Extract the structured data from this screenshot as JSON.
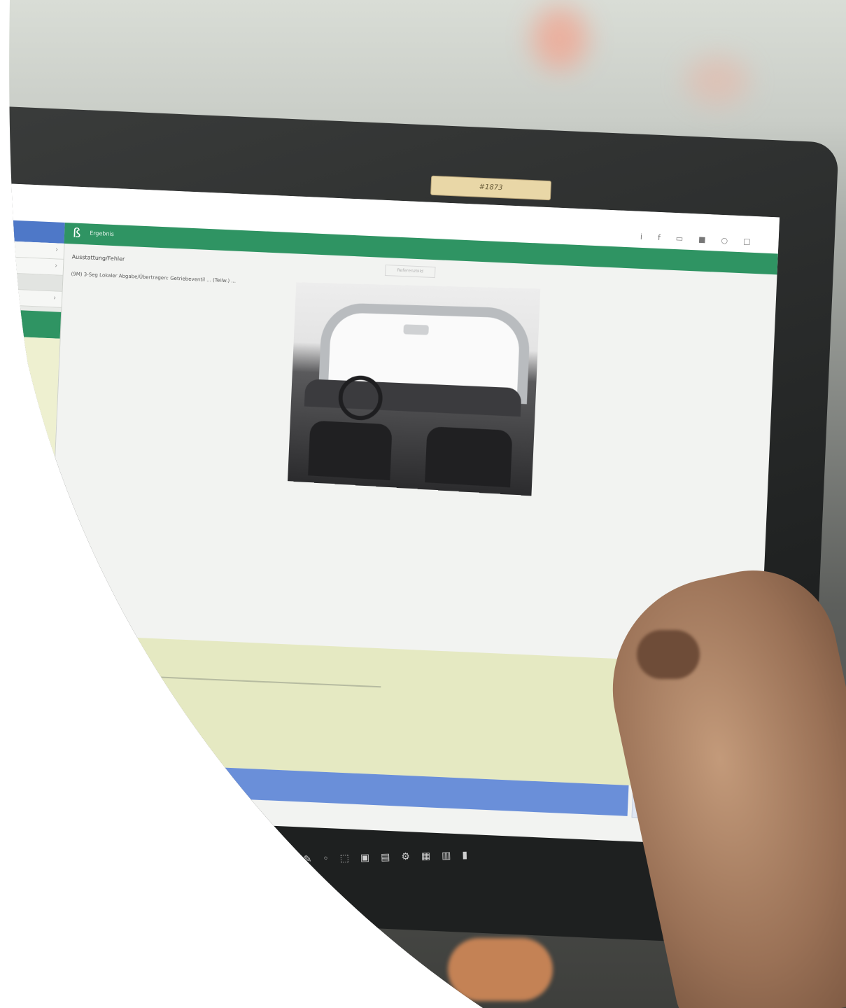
{
  "photo": {
    "description_icons": [
      "tablet-icon",
      "car-interior-icon",
      "hand-icon"
    ],
    "screen": {
      "camera_label": "#1873",
      "app_title": "...",
      "header_icons": [
        "i",
        "f",
        "▭",
        "■",
        "○",
        "□"
      ],
      "green_bar_label": "Ergebnis",
      "content_title": "Ausstattung/Fehler",
      "content_text": "(9M) 3-Seg Lokaler Abgabe/Übertragen: Getriebeventil ... (Teilw.) ...",
      "reference_label": "Referenzbild",
      "close_symbol": "✕",
      "taskbar_icons": [
        "✎",
        "◦",
        "⬚",
        "▣",
        "▤",
        "⚙",
        "▦",
        "▥",
        "▮"
      ]
    }
  },
  "colors": {
    "green": "#2f9463",
    "blue": "#4e78c8",
    "lime": "#e5e9c2"
  }
}
